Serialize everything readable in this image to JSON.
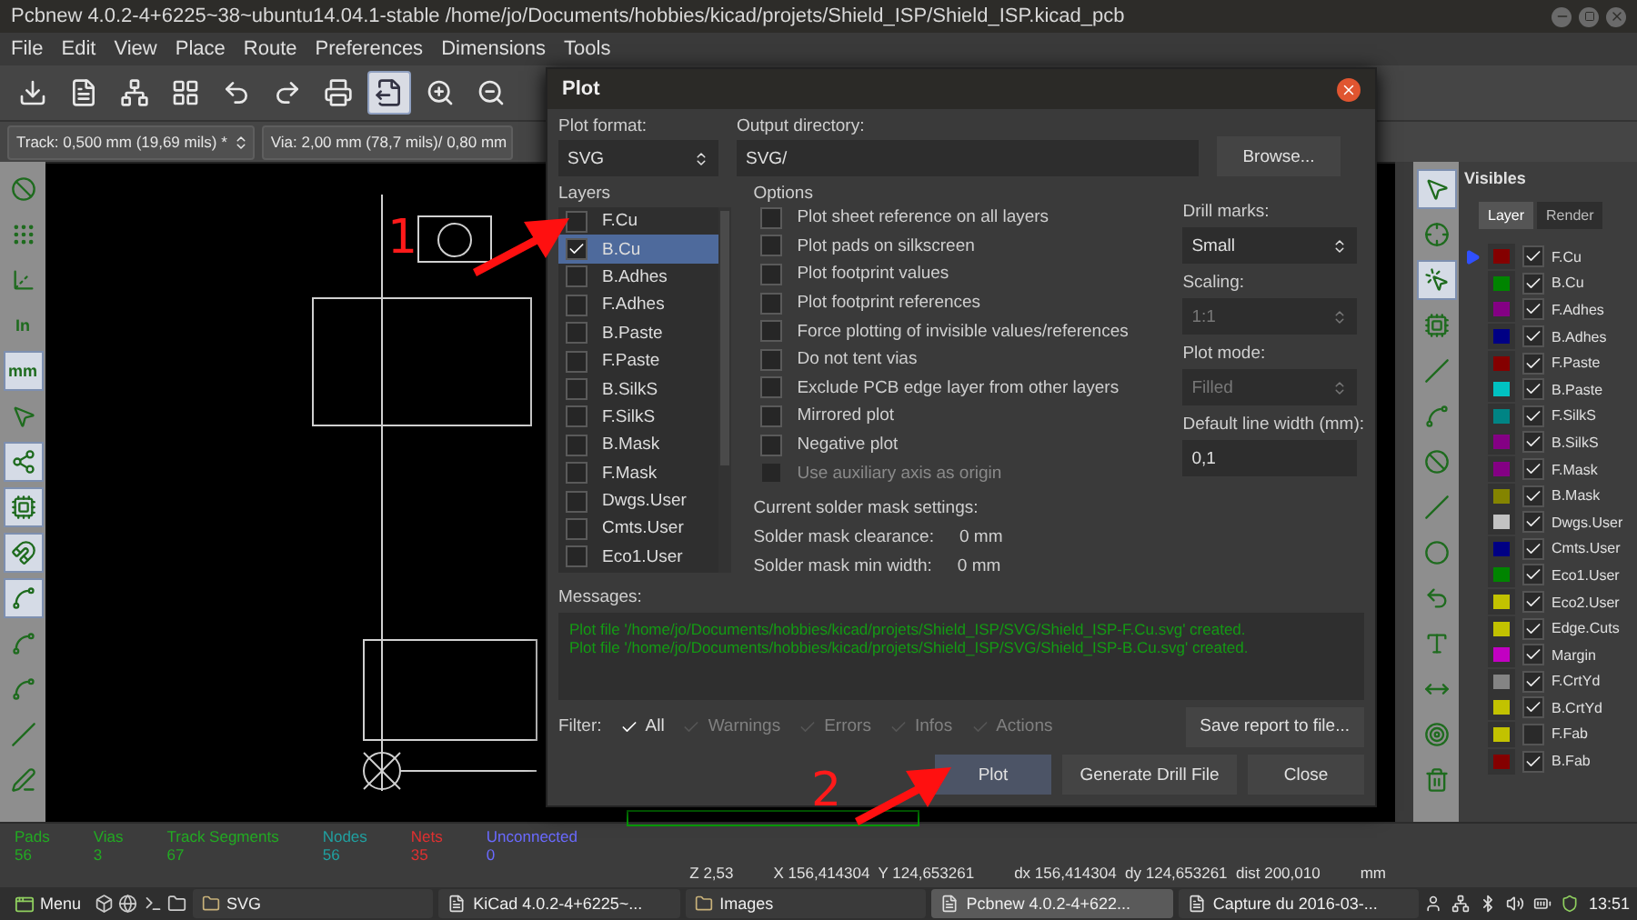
{
  "window": {
    "title": "Pcbnew 4.0.2-4+6225~38~ubuntu14.04.1-stable /home/jo/Documents/hobbies/kicad/projets/Shield_ISP/Shield_ISP.kicad_pcb"
  },
  "menu": [
    "File",
    "Edit",
    "View",
    "Place",
    "Route",
    "Preferences",
    "Dimensions",
    "Tools"
  ],
  "toolbar": [
    {
      "kind": "save",
      "selected": false
    },
    {
      "kind": "page",
      "selected": false
    },
    {
      "kind": "netlist",
      "selected": false
    },
    {
      "kind": "grid",
      "selected": false
    },
    {
      "kind": "undo",
      "selected": false
    },
    {
      "kind": "redo",
      "selected": false
    },
    {
      "kind": "print",
      "selected": false
    },
    {
      "kind": "plot",
      "selected": true
    },
    {
      "kind": "zoom-in",
      "selected": false
    },
    {
      "kind": "zoom-out",
      "selected": false
    }
  ],
  "aux_toolbar": {
    "track": "Track: 0,500 mm (19,69 mils) *",
    "via": "Via: 2,00 mm (78,7 mils)/ 0,80 mm"
  },
  "left_toolbar": [
    {
      "kind": "drc",
      "selected": false
    },
    {
      "kind": "grid",
      "selected": false
    },
    {
      "kind": "polar",
      "selected": false
    },
    {
      "kind": "units",
      "label": "In",
      "selected": false
    },
    {
      "kind": "units",
      "label": "mm",
      "selected": true
    },
    {
      "kind": "cursor",
      "selected": false
    },
    {
      "kind": "ratsnest",
      "selected": true
    },
    {
      "kind": "module",
      "selected": true
    },
    {
      "kind": "magnet",
      "selected": true
    },
    {
      "kind": "zone",
      "selected": true
    },
    {
      "kind": "zone",
      "selected": false
    },
    {
      "kind": "zone",
      "selected": false
    },
    {
      "kind": "track",
      "selected": false
    },
    {
      "kind": "via",
      "selected": false
    }
  ],
  "right_toolbar": [
    {
      "kind": "select",
      "selected": true
    },
    {
      "kind": "highlight",
      "selected": false
    },
    {
      "kind": "local",
      "selected": true
    },
    {
      "kind": "module",
      "selected": false
    },
    {
      "kind": "track",
      "selected": false
    },
    {
      "kind": "zone",
      "selected": false
    },
    {
      "kind": "keepout",
      "selected": false
    },
    {
      "kind": "line",
      "selected": false
    },
    {
      "kind": "circle",
      "selected": false
    },
    {
      "kind": "arc",
      "selected": false
    },
    {
      "kind": "text",
      "selected": false
    },
    {
      "kind": "dimension",
      "selected": false
    },
    {
      "kind": "target",
      "selected": false
    },
    {
      "kind": "delete",
      "selected": false
    }
  ],
  "layers_panel": {
    "title": "Visibles",
    "tabs": [
      {
        "label": "Layer",
        "selected": true
      },
      {
        "label": "Render",
        "selected": false
      }
    ],
    "layers": [
      {
        "name": "F.Cu",
        "color": "#840000",
        "visible": true,
        "active": true
      },
      {
        "name": "B.Cu",
        "color": "#008400",
        "visible": true,
        "active": false
      },
      {
        "name": "F.Adhes",
        "color": "#840084",
        "visible": true,
        "active": false
      },
      {
        "name": "B.Adhes",
        "color": "#000084",
        "visible": true,
        "active": false
      },
      {
        "name": "F.Paste",
        "color": "#840000",
        "visible": true,
        "active": false
      },
      {
        "name": "B.Paste",
        "color": "#00c2c2",
        "visible": true,
        "active": false
      },
      {
        "name": "F.SilkS",
        "color": "#008484",
        "visible": true,
        "active": false
      },
      {
        "name": "B.SilkS",
        "color": "#840084",
        "visible": true,
        "active": false
      },
      {
        "name": "F.Mask",
        "color": "#840084",
        "visible": true,
        "active": false
      },
      {
        "name": "B.Mask",
        "color": "#848400",
        "visible": true,
        "active": false
      },
      {
        "name": "Dwgs.User",
        "color": "#c2c2c2",
        "visible": true,
        "active": false
      },
      {
        "name": "Cmts.User",
        "color": "#000084",
        "visible": true,
        "active": false
      },
      {
        "name": "Eco1.User",
        "color": "#008400",
        "visible": true,
        "active": false
      },
      {
        "name": "Eco2.User",
        "color": "#c2c200",
        "visible": true,
        "active": false
      },
      {
        "name": "Edge.Cuts",
        "color": "#c2c200",
        "visible": true,
        "active": false
      },
      {
        "name": "Margin",
        "color": "#c200c2",
        "visible": true,
        "active": false
      },
      {
        "name": "F.CrtYd",
        "color": "#848484",
        "visible": true,
        "active": false
      },
      {
        "name": "B.CrtYd",
        "color": "#c2c200",
        "visible": true,
        "active": false
      },
      {
        "name": "F.Fab",
        "color": "#c2c200",
        "visible": false,
        "active": false
      },
      {
        "name": "B.Fab",
        "color": "#840000",
        "visible": true,
        "active": false
      }
    ]
  },
  "stats": [
    {
      "label": "Pads",
      "value": "56",
      "color": "#22aa22"
    },
    {
      "label": "Vias",
      "value": "3",
      "color": "#22aa22"
    },
    {
      "label": "Track Segments",
      "value": "67",
      "color": "#22aa22"
    },
    {
      "label": "Nodes",
      "value": "56",
      "color": "#20a0a0"
    },
    {
      "label": "Nets",
      "value": "35",
      "color": "#e03030"
    },
    {
      "label": "Unconnected",
      "value": "0",
      "color": "#6a6aff"
    }
  ],
  "coordinates": [
    "Z 2,53",
    "X 156,414304  Y 124,653261",
    "dx 156,414304  dy 124,653261  dist 200,010",
    "mm"
  ],
  "taskbar": {
    "menu": "Menu",
    "launchers": [
      {
        "kind": "box"
      },
      {
        "kind": "browser"
      },
      {
        "kind": "terminal"
      },
      {
        "kind": "folder"
      }
    ],
    "items": [
      {
        "label": "SVG",
        "kind": "folder",
        "selected": false
      },
      {
        "label": "KiCad 4.0.2-4+6225~...",
        "kind": "app",
        "selected": false
      },
      {
        "label": "Images",
        "kind": "folder",
        "selected": false
      },
      {
        "label": "Pcbnew 4.0.2-4+622...",
        "kind": "app",
        "selected": true
      },
      {
        "label": "Capture du 2016-03-...",
        "kind": "app",
        "selected": false
      }
    ],
    "clock": "13:51"
  },
  "dialog": {
    "title": "Plot",
    "plot_format_label": "Plot format:",
    "plot_format": "SVG",
    "output_dir_label": "Output directory:",
    "output_dir": "SVG/",
    "browse": "Browse...",
    "layers_label": "Layers",
    "layers": [
      {
        "name": "F.Cu",
        "checked": false,
        "selected": false
      },
      {
        "name": "B.Cu",
        "checked": true,
        "selected": true
      },
      {
        "name": "B.Adhes",
        "checked": false,
        "selected": false
      },
      {
        "name": "F.Adhes",
        "checked": false,
        "selected": false
      },
      {
        "name": "B.Paste",
        "checked": false,
        "selected": false
      },
      {
        "name": "F.Paste",
        "checked": false,
        "selected": false
      },
      {
        "name": "B.SilkS",
        "checked": false,
        "selected": false
      },
      {
        "name": "F.SilkS",
        "checked": false,
        "selected": false
      },
      {
        "name": "B.Mask",
        "checked": false,
        "selected": false
      },
      {
        "name": "F.Mask",
        "checked": false,
        "selected": false
      },
      {
        "name": "Dwgs.User",
        "checked": false,
        "selected": false
      },
      {
        "name": "Cmts.User",
        "checked": false,
        "selected": false
      },
      {
        "name": "Eco1.User",
        "checked": false,
        "selected": false
      }
    ],
    "options_label": "Options",
    "options": [
      {
        "label": "Plot sheet reference on all layers",
        "checked": false,
        "disabled": false
      },
      {
        "label": "Plot pads on silkscreen",
        "checked": false,
        "disabled": false
      },
      {
        "label": "Plot footprint values",
        "checked": false,
        "disabled": false
      },
      {
        "label": "Plot footprint references",
        "checked": false,
        "disabled": false
      },
      {
        "label": "Force plotting of invisible values/references",
        "checked": false,
        "disabled": false
      },
      {
        "label": "Do not tent vias",
        "checked": false,
        "disabled": false
      },
      {
        "label": "Exclude PCB edge layer from other layers",
        "checked": false,
        "disabled": false
      },
      {
        "label": "Mirrored plot",
        "checked": false,
        "disabled": false
      },
      {
        "label": "Negative plot",
        "checked": false,
        "disabled": false
      },
      {
        "label": "Use auxiliary axis as origin",
        "checked": false,
        "disabled": true
      }
    ],
    "settings": [
      {
        "label": "Drill marks:",
        "value": "Small",
        "kind": "select",
        "disabled": false
      },
      {
        "label": "Scaling:",
        "value": "1:1",
        "kind": "select",
        "disabled": true
      },
      {
        "label": "Plot mode:",
        "value": "Filled",
        "kind": "select",
        "disabled": true
      },
      {
        "label": "Default line width (mm):",
        "value": "0,1",
        "kind": "input",
        "disabled": false
      }
    ],
    "solder_mask_title": "Current solder mask settings:",
    "solder_mask": [
      {
        "label": "Solder mask clearance:",
        "value": "0 mm"
      },
      {
        "label": "Solder mask min width:",
        "value": "0 mm"
      }
    ],
    "messages_label": "Messages:",
    "messages": [
      "Plot file '/home/jo/Documents/hobbies/kicad/projets/Shield_ISP/SVG/Shield_ISP-F.Cu.svg' created.",
      "Plot file '/home/jo/Documents/hobbies/kicad/projets/Shield_ISP/SVG/Shield_ISP-B.Cu.svg' created."
    ],
    "filter_label": "Filter:",
    "filters": [
      {
        "label": "All",
        "checked": true
      },
      {
        "label": "Warnings",
        "checked": false
      },
      {
        "label": "Errors",
        "checked": false
      },
      {
        "label": "Infos",
        "checked": false
      },
      {
        "label": "Actions",
        "checked": false
      }
    ],
    "save_report": "Save report to file...",
    "buttons": [
      {
        "label": "Plot",
        "selected": true
      },
      {
        "label": "Generate Drill File",
        "selected": false
      },
      {
        "label": "Close",
        "selected": false
      }
    ]
  },
  "annotations": [
    "1",
    "2"
  ]
}
